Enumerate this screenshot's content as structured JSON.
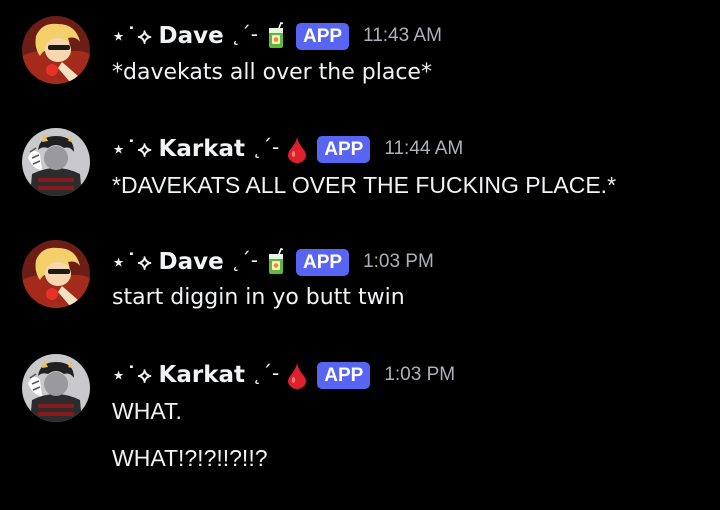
{
  "messages": [
    {
      "prefix": "⋆˙⟡",
      "author": "Dave",
      "decoration": "˛ˊ-",
      "role_icon": "juice-box-icon",
      "badge": "APP",
      "time": "11:43 AM",
      "lines": [
        "*davekats all over the place*"
      ]
    },
    {
      "prefix": "⋆˙⟡",
      "author": "Karkat",
      "decoration": "˛ˊ-",
      "role_icon": "blood-drop-icon",
      "badge": "APP",
      "time": "11:44 AM",
      "lines": [
        "*DAVEKATS ALL OVER THE FUCKING PLACE.*"
      ]
    },
    {
      "prefix": "⋆˙⟡",
      "author": "Dave",
      "decoration": "˛ˊ-",
      "role_icon": "juice-box-icon",
      "badge": "APP",
      "time": "1:03 PM",
      "lines": [
        "start diggin in yo butt twin"
      ]
    },
    {
      "prefix": "⋆˙⟡",
      "author": "Karkat",
      "decoration": "˛ˊ-",
      "role_icon": "blood-drop-icon",
      "badge": "APP",
      "time": "1:03 PM",
      "lines": [
        "WHAT.",
        "WHAT!?!?!!?!!?"
      ]
    }
  ],
  "colors": {
    "background": "#000000",
    "text": "#f2f3f5",
    "timestamp": "#aeb0b7",
    "app_badge": "#5865f2",
    "blood_drop": "#e0202a",
    "juice_box": "#5fb83a"
  }
}
